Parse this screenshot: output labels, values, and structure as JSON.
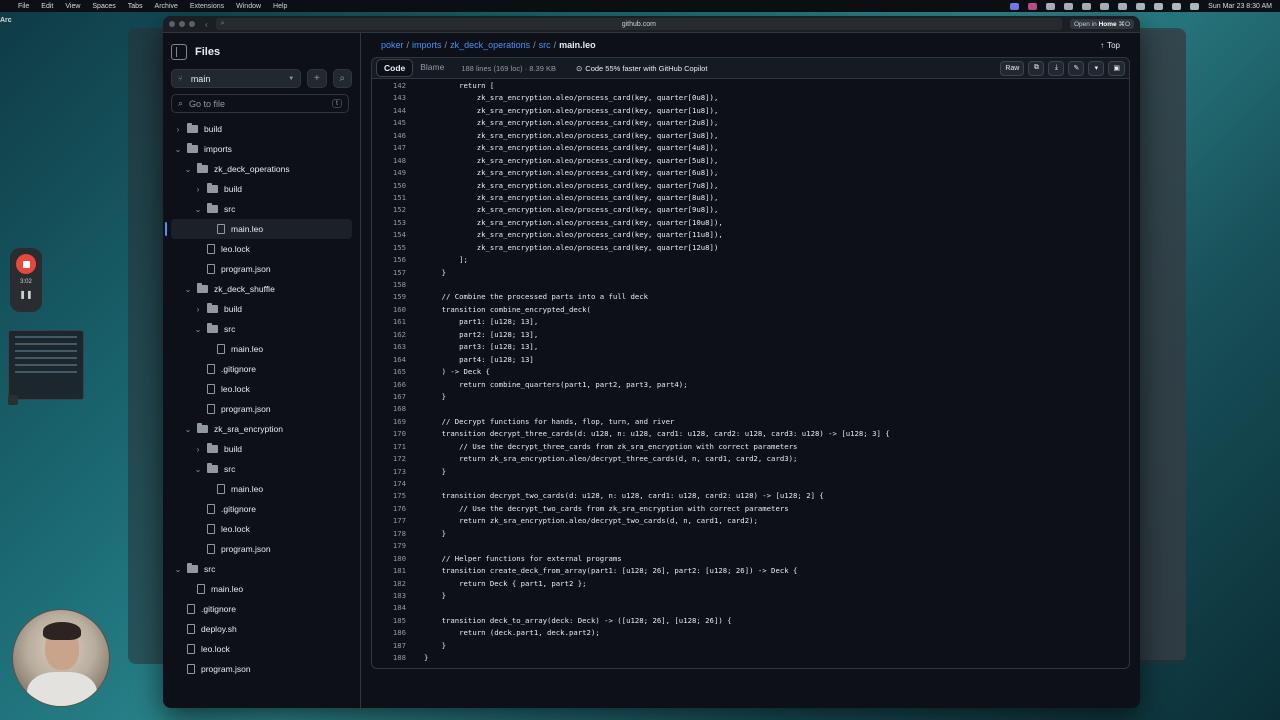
{
  "menubar": {
    "app_name": "Arc",
    "items": [
      "File",
      "Edit",
      "View",
      "Spaces",
      "Tabs",
      "Archive",
      "Extensions",
      "Window",
      "Help"
    ],
    "clock": "Sun Mar 23  8:30 AM"
  },
  "browser": {
    "url": "github.com",
    "open_in_prefix": "Open in",
    "open_in_app": "Home",
    "open_in_shortcut": "⌘O"
  },
  "sidebar": {
    "title": "Files",
    "branch": "main",
    "goto_placeholder": "Go to file",
    "goto_shortcut": "t",
    "tree": [
      {
        "label": "build",
        "type": "folder",
        "depth": 0,
        "expanded": false
      },
      {
        "label": "imports",
        "type": "folder",
        "depth": 0,
        "expanded": true
      },
      {
        "label": "zk_deck_operations",
        "type": "folder",
        "depth": 1,
        "expanded": true
      },
      {
        "label": "build",
        "type": "folder",
        "depth": 2,
        "expanded": false
      },
      {
        "label": "src",
        "type": "folder",
        "depth": 2,
        "expanded": true
      },
      {
        "label": "main.leo",
        "type": "file",
        "depth": 3,
        "selected": true
      },
      {
        "label": "leo.lock",
        "type": "file",
        "depth": 2
      },
      {
        "label": "program.json",
        "type": "file",
        "depth": 2
      },
      {
        "label": "zk_deck_shuffle",
        "type": "folder",
        "depth": 1,
        "expanded": true
      },
      {
        "label": "build",
        "type": "folder",
        "depth": 2,
        "expanded": false
      },
      {
        "label": "src",
        "type": "folder",
        "depth": 2,
        "expanded": true
      },
      {
        "label": "main.leo",
        "type": "file",
        "depth": 3
      },
      {
        "label": ".gitignore",
        "type": "file",
        "depth": 2
      },
      {
        "label": "leo.lock",
        "type": "file",
        "depth": 2
      },
      {
        "label": "program.json",
        "type": "file",
        "depth": 2
      },
      {
        "label": "zk_sra_encryption",
        "type": "folder",
        "depth": 1,
        "expanded": true
      },
      {
        "label": "build",
        "type": "folder",
        "depth": 2,
        "expanded": false
      },
      {
        "label": "src",
        "type": "folder",
        "depth": 2,
        "expanded": true
      },
      {
        "label": "main.leo",
        "type": "file",
        "depth": 3
      },
      {
        "label": ".gitignore",
        "type": "file",
        "depth": 2
      },
      {
        "label": "leo.lock",
        "type": "file",
        "depth": 2
      },
      {
        "label": "program.json",
        "type": "file",
        "depth": 2
      },
      {
        "label": "src",
        "type": "folder",
        "depth": 0,
        "expanded": true
      },
      {
        "label": "main.leo",
        "type": "file",
        "depth": 1
      },
      {
        "label": ".gitignore",
        "type": "file",
        "depth": 0
      },
      {
        "label": "deploy.sh",
        "type": "file",
        "depth": 0
      },
      {
        "label": "leo.lock",
        "type": "file",
        "depth": 0
      },
      {
        "label": "program.json",
        "type": "file",
        "depth": 0
      }
    ]
  },
  "breadcrumb": {
    "parts": [
      "poker",
      "imports",
      "zk_deck_operations",
      "src"
    ],
    "current": "main.leo",
    "top_label": "Top"
  },
  "file_header": {
    "tab_code": "Code",
    "tab_blame": "Blame",
    "meta": "188 lines (169 loc) · 8.39 KB",
    "copilot": "Code 55% faster with GitHub Copilot",
    "raw_label": "Raw"
  },
  "code_lines": [
    {
      "n": "142",
      "t": "        return ["
    },
    {
      "n": "143",
      "t": "            zk_sra_encryption.aleo/process_card(key, quarter[0u8]),"
    },
    {
      "n": "144",
      "t": "            zk_sra_encryption.aleo/process_card(key, quarter[1u8]),"
    },
    {
      "n": "145",
      "t": "            zk_sra_encryption.aleo/process_card(key, quarter[2u8]),"
    },
    {
      "n": "146",
      "t": "            zk_sra_encryption.aleo/process_card(key, quarter[3u8]),"
    },
    {
      "n": "147",
      "t": "            zk_sra_encryption.aleo/process_card(key, quarter[4u8]),"
    },
    {
      "n": "148",
      "t": "            zk_sra_encryption.aleo/process_card(key, quarter[5u8]),"
    },
    {
      "n": "149",
      "t": "            zk_sra_encryption.aleo/process_card(key, quarter[6u8]),"
    },
    {
      "n": "150",
      "t": "            zk_sra_encryption.aleo/process_card(key, quarter[7u8]),"
    },
    {
      "n": "151",
      "t": "            zk_sra_encryption.aleo/process_card(key, quarter[8u8]),"
    },
    {
      "n": "152",
      "t": "            zk_sra_encryption.aleo/process_card(key, quarter[9u8]),"
    },
    {
      "n": "153",
      "t": "            zk_sra_encryption.aleo/process_card(key, quarter[10u8]),"
    },
    {
      "n": "154",
      "t": "            zk_sra_encryption.aleo/process_card(key, quarter[11u8]),"
    },
    {
      "n": "155",
      "t": "            zk_sra_encryption.aleo/process_card(key, quarter[12u8])"
    },
    {
      "n": "156",
      "t": "        ];"
    },
    {
      "n": "157",
      "t": "    }"
    },
    {
      "n": "158",
      "t": ""
    },
    {
      "n": "159",
      "t": "    // Combine the processed parts into a full deck"
    },
    {
      "n": "160",
      "t": "    transition combine_encrypted_deck("
    },
    {
      "n": "161",
      "t": "        part1: [u128; 13],"
    },
    {
      "n": "162",
      "t": "        part2: [u128; 13],"
    },
    {
      "n": "163",
      "t": "        part3: [u128; 13],"
    },
    {
      "n": "164",
      "t": "        part4: [u128; 13]"
    },
    {
      "n": "165",
      "t": "    ) -> Deck {"
    },
    {
      "n": "166",
      "t": "        return combine_quarters(part1, part2, part3, part4);"
    },
    {
      "n": "167",
      "t": "    }"
    },
    {
      "n": "168",
      "t": ""
    },
    {
      "n": "169",
      "t": "    // Decrypt functions for hands, flop, turn, and river"
    },
    {
      "n": "170",
      "t": "    transition decrypt_three_cards(d: u128, n: u128, card1: u128, card2: u128, card3: u128) -> [u128; 3] {"
    },
    {
      "n": "171",
      "t": "        // Use the decrypt_three_cards from zk_sra_encryption with correct parameters"
    },
    {
      "n": "172",
      "t": "        return zk_sra_encryption.aleo/decrypt_three_cards(d, n, card1, card2, card3);"
    },
    {
      "n": "173",
      "t": "    }"
    },
    {
      "n": "174",
      "t": ""
    },
    {
      "n": "175",
      "t": "    transition decrypt_two_cards(d: u128, n: u128, card1: u128, card2: u128) -> [u128; 2] {"
    },
    {
      "n": "176",
      "t": "        // Use the decrypt_two_cards from zk_sra_encryption with correct parameters"
    },
    {
      "n": "177",
      "t": "        return zk_sra_encryption.aleo/decrypt_two_cards(d, n, card1, card2);"
    },
    {
      "n": "178",
      "t": "    }"
    },
    {
      "n": "179",
      "t": ""
    },
    {
      "n": "180",
      "t": "    // Helper functions for external programs"
    },
    {
      "n": "181",
      "t": "    transition create_deck_from_array(part1: [u128; 26], part2: [u128; 26]) -> Deck {"
    },
    {
      "n": "182",
      "t": "        return Deck { part1, part2 };"
    },
    {
      "n": "183",
      "t": "    }"
    },
    {
      "n": "184",
      "t": ""
    },
    {
      "n": "185",
      "t": "    transition deck_to_array(deck: Deck) -> ([u128; 26], [u128; 26]) {"
    },
    {
      "n": "186",
      "t": "        return (deck.part1, deck.part2);"
    },
    {
      "n": "187",
      "t": "    }"
    },
    {
      "n": "188",
      "t": "}"
    }
  ],
  "recorder": {
    "time": "3:02"
  },
  "colors": {
    "accent_link": "#4493f8",
    "record_red": "#e5483d",
    "bg_dark": "#0d1117"
  }
}
